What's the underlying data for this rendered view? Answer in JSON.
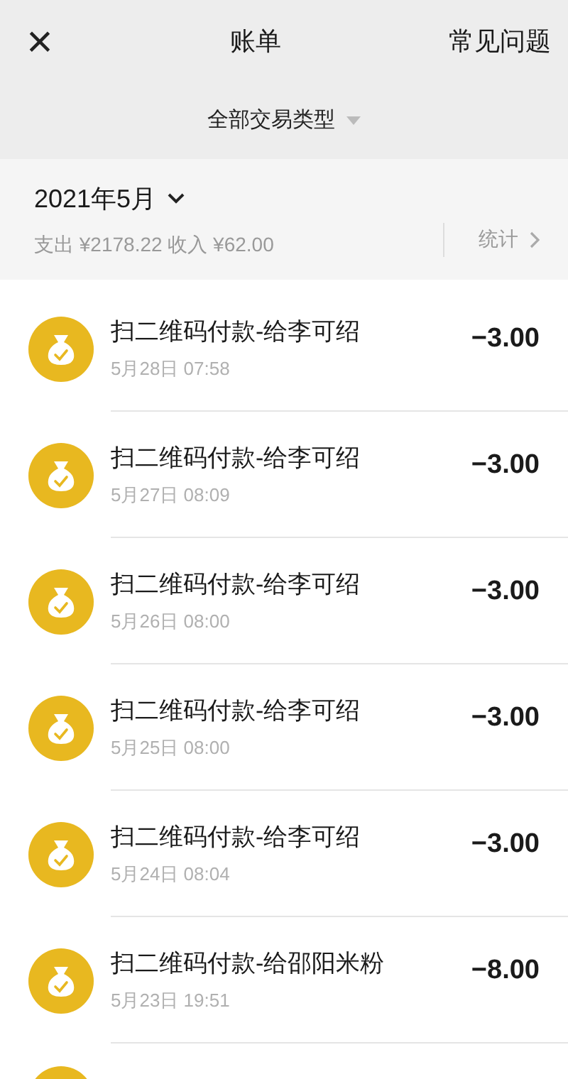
{
  "header": {
    "close": "×",
    "title": "账单",
    "help": "常见问题"
  },
  "filter": {
    "label": "全部交易类型"
  },
  "summary": {
    "month": "2021年5月",
    "totals": "支出 ¥2178.22 收入 ¥62.00",
    "stats": "统计"
  },
  "transactions": [
    {
      "kind": "full",
      "title": "扫二维码付款-给李可绍",
      "time": "5月28日 07:58",
      "amount": "−3.00"
    },
    {
      "kind": "full",
      "title": "扫二维码付款-给李可绍",
      "time": "5月27日 08:09",
      "amount": "−3.00"
    },
    {
      "kind": "full",
      "title": "扫二维码付款-给李可绍",
      "time": "5月26日 08:00",
      "amount": "−3.00"
    },
    {
      "kind": "full",
      "title": "扫二维码付款-给李可绍",
      "time": "5月25日 08:00",
      "amount": "−3.00"
    },
    {
      "kind": "full",
      "title": "扫二维码付款-给李可绍",
      "time": "5月24日 08:04",
      "amount": "−3.00"
    },
    {
      "kind": "full",
      "title": "扫二维码付款-给邵阳米粉",
      "time": "5月23日 19:51",
      "amount": "−8.00"
    },
    {
      "kind": "partial"
    }
  ]
}
